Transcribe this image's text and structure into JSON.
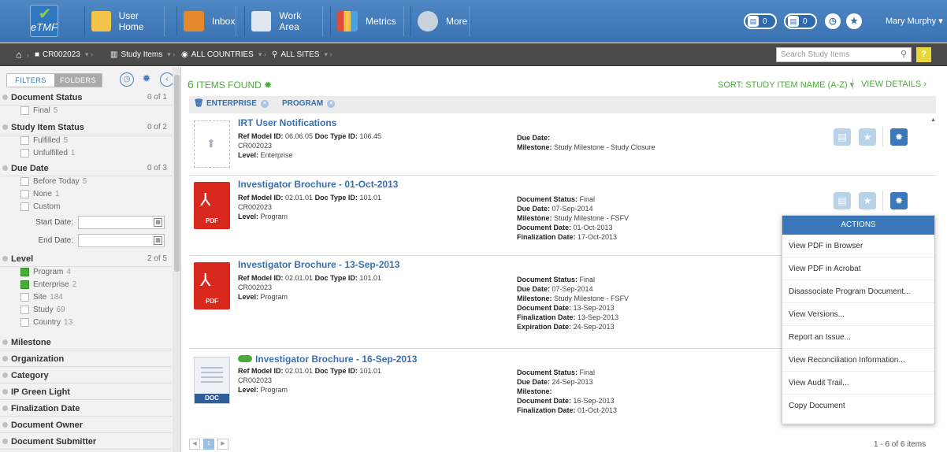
{
  "app": {
    "logo_text": "eTMF"
  },
  "nav": {
    "items": [
      {
        "label": "User Home",
        "icon": "house-icon"
      },
      {
        "label": "Inbox",
        "icon": "inbox-icon"
      },
      {
        "label": "Work Area",
        "icon": "document-icon"
      },
      {
        "label": "Metrics",
        "icon": "bar-chart-icon"
      },
      {
        "label": "More",
        "icon": "gear-icon"
      }
    ],
    "badges": [
      {
        "count": "0"
      },
      {
        "count": "0"
      }
    ],
    "user": "Mary Murphy"
  },
  "breadcrumb": {
    "home": "home-icon",
    "items": [
      "CR002023",
      "Study Items",
      "ALL COUNTRIES",
      "ALL SITES"
    ],
    "search_placeholder": "Search Study Items",
    "help": "?"
  },
  "sidebar": {
    "tabs": [
      "FILTERS",
      "FOLDERS"
    ],
    "sections": [
      {
        "label": "Document Status",
        "count": "0 of 1",
        "options": [
          {
            "label": "Final",
            "num": "5",
            "checked": false
          }
        ]
      },
      {
        "label": "Study Item Status",
        "count": "0 of 2",
        "options": [
          {
            "label": "Fulfilled",
            "num": "5",
            "checked": false
          },
          {
            "label": "Unfulfilled",
            "num": "1",
            "checked": false
          }
        ]
      },
      {
        "label": "Due Date",
        "count": "0 of 3",
        "options": [
          {
            "label": "Before Today",
            "num": "5",
            "checked": false
          },
          {
            "label": "None",
            "num": "1",
            "checked": false
          },
          {
            "label": "Custom",
            "num": "",
            "checked": false
          }
        ]
      },
      {
        "label": "Level",
        "count": "2 of 5",
        "options": [
          {
            "label": "Program",
            "num": "4",
            "checked": true
          },
          {
            "label": "Enterprise",
            "num": "2",
            "checked": true
          },
          {
            "label": "Site",
            "num": "184",
            "checked": false
          },
          {
            "label": "Study",
            "num": "69",
            "checked": false
          },
          {
            "label": "Country",
            "num": "13",
            "checked": false
          }
        ]
      }
    ],
    "start_date_label": "Start Date:",
    "end_date_label": "End Date:",
    "collapsed": [
      "Milestone",
      "Organization",
      "Category",
      "IP Green Light",
      "Finalization Date",
      "Document Owner",
      "Document Submitter"
    ]
  },
  "main": {
    "found_count": "6",
    "found_label": "ITEMS FOUND",
    "sort_label": "SORT: STUDY ITEM NAME (A-Z)",
    "view_details": "VIEW DETAILS",
    "chips": [
      "ENTERPRISE",
      "PROGRAM"
    ],
    "items": [
      {
        "title": "IRT User Notifications",
        "ref": "06.06.05",
        "doctype": "106.45",
        "study": "CR002023",
        "level": "Enterprise",
        "doc_status": "",
        "due_date": "",
        "milestone": "Study Milestone - Study Closure",
        "doc_date": "",
        "final_date": "",
        "exp_date": "",
        "type": "upload"
      },
      {
        "title": "Investigator Brochure - 01-Oct-2013",
        "ref": "02.01.01",
        "doctype": "101.01",
        "study": "CR002023",
        "level": "Program",
        "doc_status": "Final",
        "due_date": "07-Sep-2014",
        "milestone": "Study Milestone - FSFV",
        "doc_date": "01-Oct-2013",
        "final_date": "17-Oct-2013",
        "exp_date": "",
        "type": "pdf"
      },
      {
        "title": "Investigator Brochure - 13-Sep-2013",
        "ref": "02.01.01",
        "doctype": "101.01",
        "study": "CR002023",
        "level": "Program",
        "doc_status": "Final",
        "due_date": "07-Sep-2014",
        "milestone": "Study Milestone - FSFV",
        "doc_date": "13-Sep-2013",
        "final_date": "13-Sep-2013",
        "exp_date": "24-Sep-2013",
        "type": "pdf"
      },
      {
        "title": "Investigator Brochure - 16-Sep-2013",
        "ref": "02.01.01",
        "doctype": "101.01",
        "study": "CR002023",
        "level": "Program",
        "doc_status": "Final",
        "due_date": "24-Sep-2013",
        "milestone": "",
        "doc_date": "16-Sep-2013",
        "final_date": "01-Oct-2013",
        "exp_date": "",
        "type": "doc"
      }
    ],
    "labels": {
      "ref": "Ref Model ID:",
      "doctype": "Doc Type ID:",
      "level": "Level:",
      "doc_status": "Document Status:",
      "due_date": "Due Date:",
      "milestone": "Milestone:",
      "doc_date": "Document Date:",
      "final_date": "Finalization Date:",
      "exp_date": "Expiration Date:"
    },
    "pdf_label": "PDF",
    "doc_label": "DOC",
    "pager_page": "1",
    "pager_count": "1 - 6 of 6 items"
  },
  "actions_menu": {
    "title": "ACTIONS",
    "items": [
      "View PDF in Browser",
      "View PDF in Acrobat",
      "Disassociate Program Document...",
      "View Versions...",
      "Report an Issue...",
      "View Reconciliation Information...",
      "View Audit Trail...",
      "Copy Document"
    ]
  },
  "colors": {
    "brand": "#3b72b3",
    "accent_green": "#4caa3a",
    "action_blue": "#3a78b9"
  }
}
